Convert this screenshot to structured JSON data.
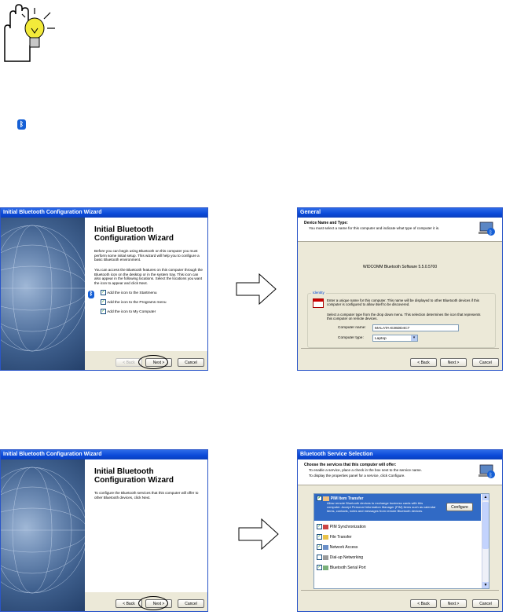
{
  "tip_icon": "hand-lightbulb-icon",
  "bluetooth_icon": "bluetooth-icon",
  "wizard1": {
    "title_bar": "Initial Bluetooth Configuration Wizard",
    "heading": "Initial Bluetooth Configuration Wizard",
    "para1": "Before you can begin using Bluetooth on this computer you must perform some initial setup. This wizard will help you to configure a basic Bluetooth environment.",
    "para2": "You can access the Bluetooth features on this computer through the Bluetooth icon on the desktop or in the system tray. This icon can also appear in the following locations. Select the locations you want the icon to appear and click Next.",
    "check1": "Add the icon to the Startmenu",
    "check2": "Add the icon to the Programs menu",
    "check3": "Add the icon to My Computer",
    "back": "< Back",
    "next": "Next >",
    "cancel": "Cancel"
  },
  "general": {
    "title_bar": "General",
    "header_title": "Device Name and Type:",
    "header_sub": "You must select a name for this computer and indicate what type of computer it is.",
    "software": "WIDCOMM Bluetooth Software 5.5.0.5700",
    "identity_label": "Identity",
    "identity_text": "Enter a unique name for this computer. This name will be displayed to other Bluetooth devices if this computer is configured to allow itself to be discovered.",
    "select_text": "Select a computer type from the drop down menu. This selection determines the icon that represents this computer on remote devices.",
    "name_label": "Computer name:",
    "name_value": "MALATA-E36DD4C7",
    "type_label": "Computer type:",
    "type_value": "Laptop",
    "back": "< Back",
    "next": "Next >",
    "cancel": "Cancel"
  },
  "wizard2": {
    "title_bar": "Initial Bluetooth Configuration Wizard",
    "heading": "Initial Bluetooth Configuration Wizard",
    "para1": "To configure the Bluetooth services that this computer will offer to other Bluetooth devices, click Next.",
    "back": "< Back",
    "next": "Next >",
    "cancel": "Cancel"
  },
  "services": {
    "title_bar": "Bluetooth Service Selection",
    "header_title": "Choose the services that this computer will offer:",
    "header_sub1": "To enable a service, place a check in the box next to the service name.",
    "header_sub2": "To display the properties panel for a service, click Configure.",
    "items": [
      {
        "label": "PIM Item Transfer",
        "checked": true
      },
      {
        "label": "PIM Synchronization",
        "checked": true
      },
      {
        "label": "File Transfer",
        "checked": true
      },
      {
        "label": "Network Access",
        "checked": true
      },
      {
        "label": "Dial-up Networking",
        "checked": false
      },
      {
        "label": "Bluetooth Serial Port",
        "checked": true
      }
    ],
    "pim_desc": "Allow remote Bluetooth devices to exchange business cards with this computer. Accept Personal Information Manager (PIM) items such as calendar items, contacts, notes and messages from remote Bluetooth devices.",
    "configure": "Configure",
    "back": "< Back",
    "next": "Next >",
    "cancel": "Cancel"
  }
}
